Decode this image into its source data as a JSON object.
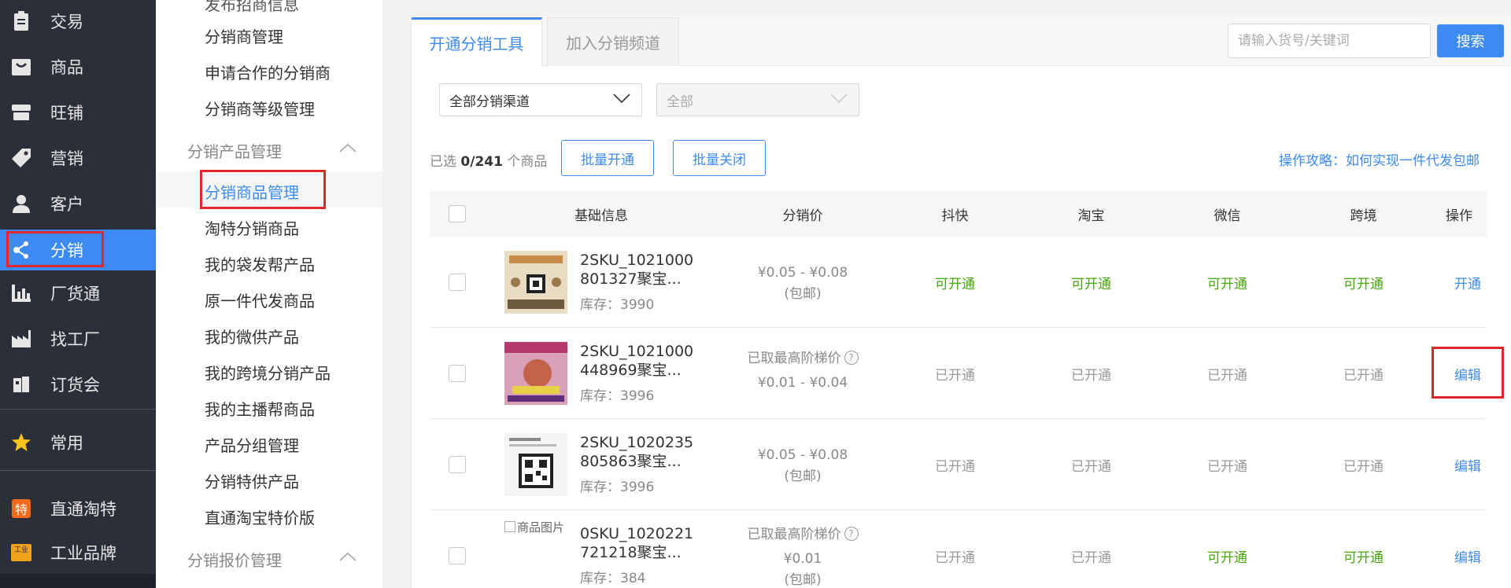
{
  "nav": {
    "items": [
      {
        "label": "交易",
        "icon": "clipboard-icon"
      },
      {
        "label": "商品",
        "icon": "shopping-bag-icon"
      },
      {
        "label": "旺铺",
        "icon": "store-icon"
      },
      {
        "label": "营销",
        "icon": "tag-icon"
      },
      {
        "label": "客户",
        "icon": "user-icon"
      },
      {
        "label": "分销",
        "icon": "share-nodes-icon",
        "active": true
      },
      {
        "label": "厂货通",
        "icon": "factory-chart-icon"
      },
      {
        "label": "找工厂",
        "icon": "factory-icon"
      },
      {
        "label": "订货会",
        "icon": "booklet-icon"
      },
      {
        "label": "常用",
        "icon": "star-icon"
      },
      {
        "label": "直通淘特",
        "icon": "te-badge-icon",
        "badge": "特"
      },
      {
        "label": "工业品牌",
        "icon": "industry-brand-icon",
        "badge": "工业"
      }
    ],
    "colors": {
      "bg": "#2b2f3a",
      "active": "#3d8bf2",
      "highlight": "#e3262b"
    }
  },
  "submenu": {
    "top_partial": "发布招商信息",
    "items_a": [
      "分销商管理",
      "申请合作的分销商",
      "分销商等级管理"
    ],
    "group_products": "分销产品管理",
    "items_b": [
      "分销商品管理",
      "淘特分销商品",
      "我的袋发帮产品",
      "原一件代发商品",
      "我的微供产品",
      "我的跨境分销产品",
      "我的主播帮商品",
      "产品分组管理",
      "分销特供产品",
      "直通淘宝特价版"
    ],
    "group_quotes": "分销报价管理"
  },
  "tabs": [
    "开通分销工具",
    "加入分销频道"
  ],
  "search": {
    "placeholder": "请输入货号/关键词",
    "button": "搜索"
  },
  "filters": {
    "channel": "全部分销渠道",
    "sub": "全部"
  },
  "selection": {
    "prefix": "已选 ",
    "count": "0/241",
    "suffix": " 个商品"
  },
  "actions": {
    "batch_open": "批量开通",
    "batch_close": "批量关闭"
  },
  "guide": "操作攻略：如何实现一件代发包邮",
  "table": {
    "headers": [
      "基础信息",
      "分销价",
      "抖快",
      "淘宝",
      "微信",
      "跨境",
      "操作"
    ],
    "rows": [
      {
        "name": "2SKU_1021000801327聚宝...",
        "stock": "库存：3990",
        "price": "¥0.05 - ¥0.08",
        "price_note": "(包邮)",
        "tier_label": "",
        "channels": [
          "可开通",
          "可开通",
          "可开通",
          "可开通"
        ],
        "action": "开通"
      },
      {
        "name": "2SKU_1021000448969聚宝...",
        "stock": "库存：3996",
        "price": "¥0.01 - ¥0.04",
        "price_note": "",
        "tier_label": "已取最高阶梯价",
        "channels": [
          "已开通",
          "已开通",
          "已开通",
          "已开通"
        ],
        "action": "编辑"
      },
      {
        "name": "2SKU_1020235805863聚宝...",
        "stock": "库存：3996",
        "price": "¥0.05 - ¥0.08",
        "price_note": "(包邮)",
        "tier_label": "",
        "channels": [
          "已开通",
          "已开通",
          "已开通",
          "已开通"
        ],
        "action": "编辑"
      },
      {
        "name": "0SKU_1020221721218聚宝...",
        "stock": "库存：384",
        "price": "¥0.01",
        "price_note": "(包邮)",
        "tier_label": "已取最高阶梯价",
        "channels": [
          "已开通",
          "已开通",
          "可开通",
          "可开通"
        ],
        "action": "编辑",
        "image_alt": "商品图片"
      }
    ]
  }
}
